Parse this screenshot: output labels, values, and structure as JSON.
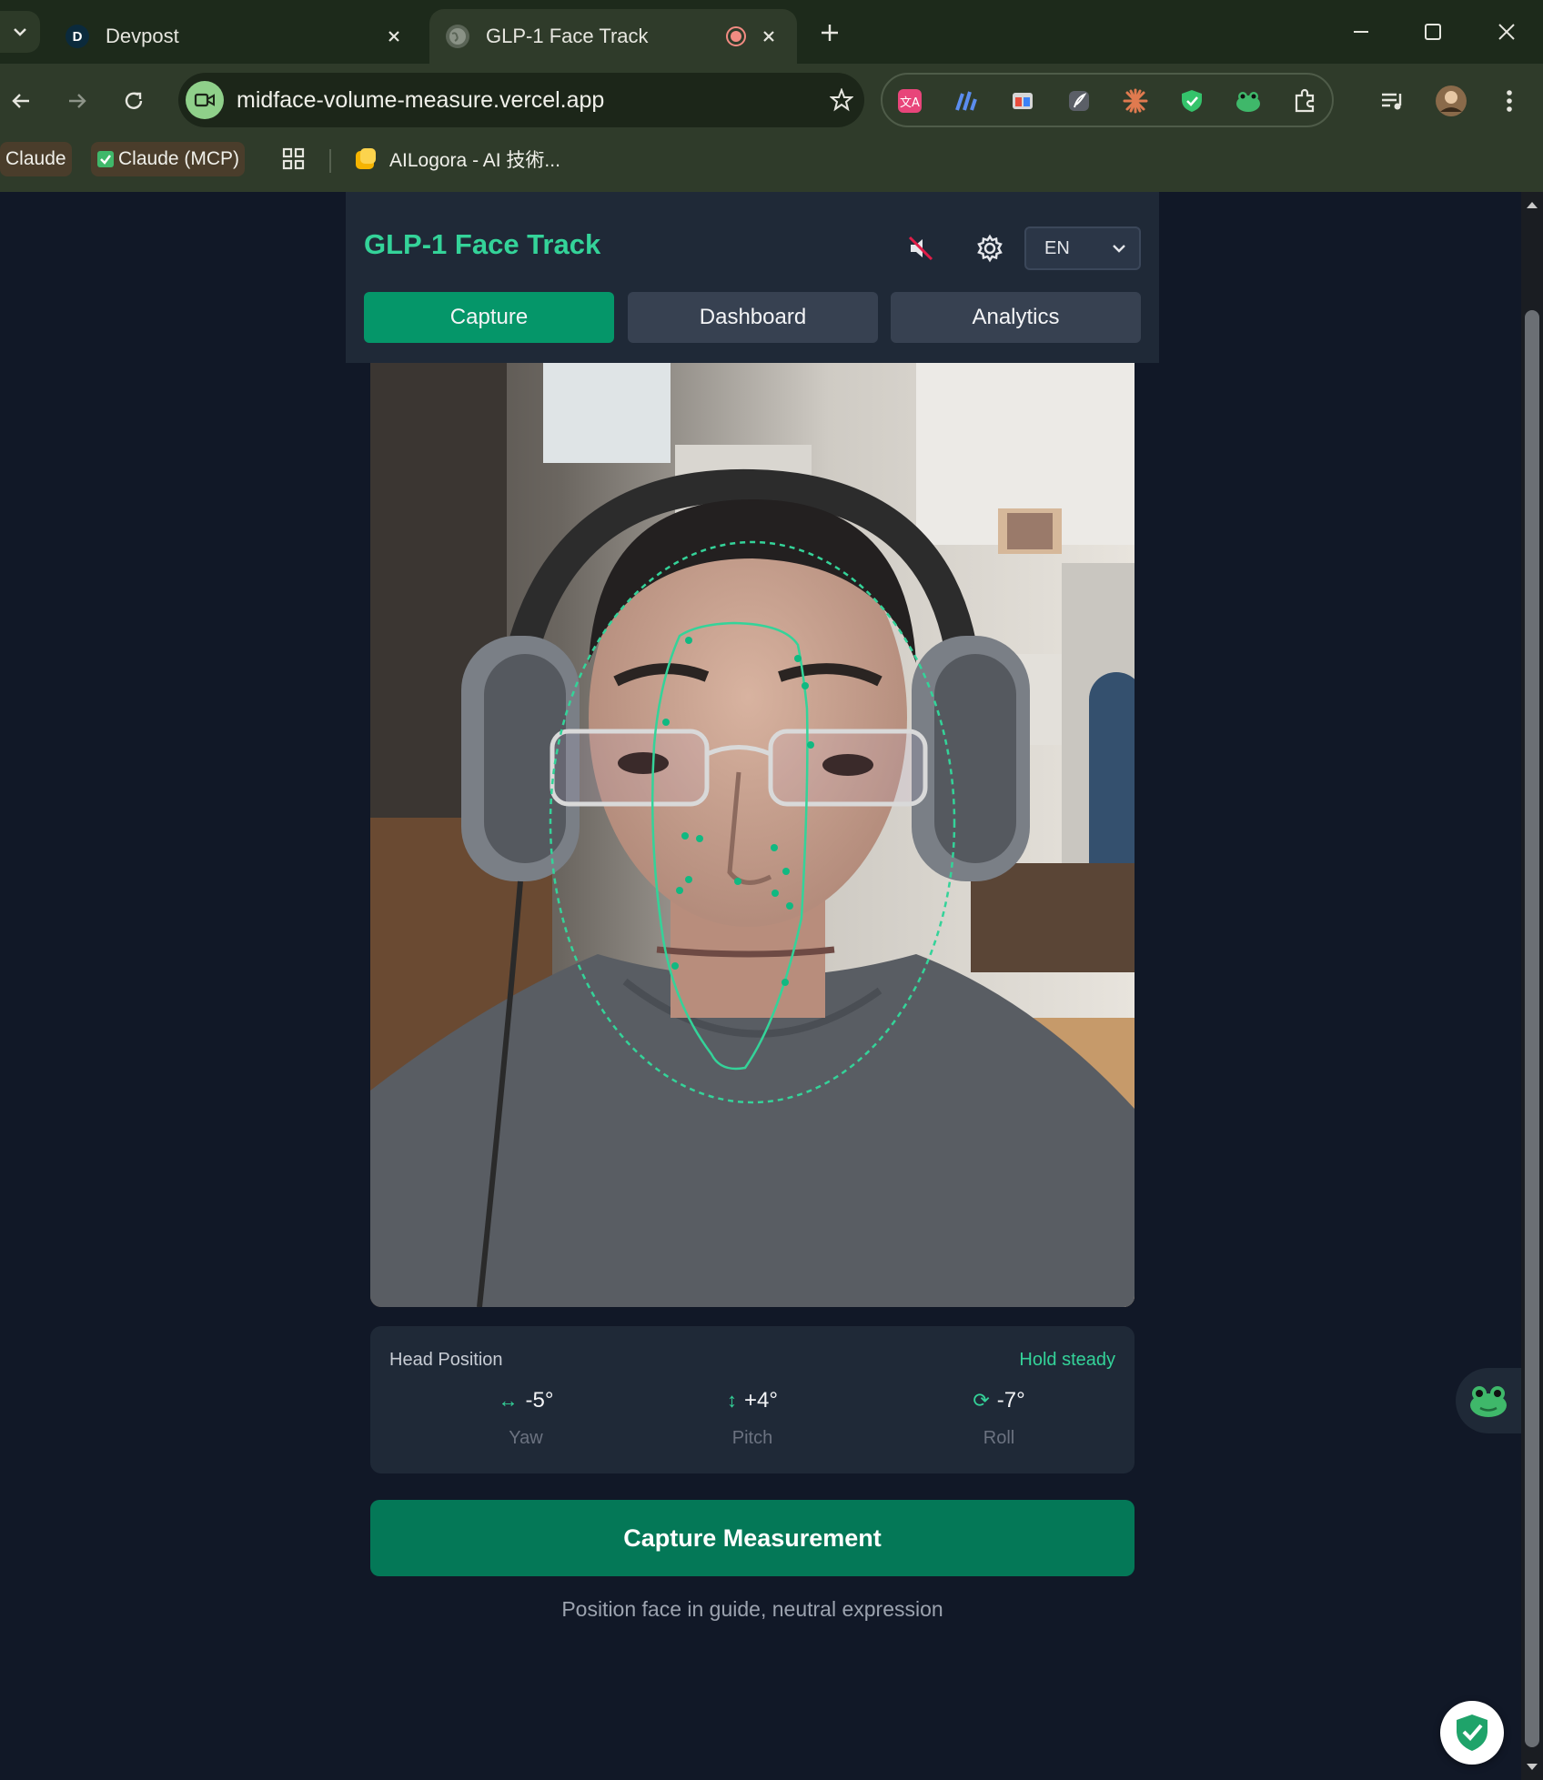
{
  "browser": {
    "tabs": [
      {
        "title": "Devpost",
        "favicon_letter": "D",
        "active": false
      },
      {
        "title": "GLP-1 Face Track",
        "active": true
      }
    ],
    "url": "midface-volume-measure.vercel.app",
    "bookmarks": [
      {
        "label": "Claude"
      },
      {
        "label": "Claude (MCP)"
      },
      {
        "label": "AILogora - AI 技術..."
      }
    ]
  },
  "app": {
    "title": "GLP-1 Face Track",
    "language": "EN",
    "nav_tabs": [
      {
        "label": "Capture",
        "active": true
      },
      {
        "label": "Dashboard",
        "active": false
      },
      {
        "label": "Analytics",
        "active": false
      }
    ],
    "head_position": {
      "title": "Head Position",
      "status": "Hold steady",
      "metrics": [
        {
          "label": "Yaw",
          "value": "-5°",
          "icon": "horizontal-arrow-icon"
        },
        {
          "label": "Pitch",
          "value": "+4°",
          "icon": "vertical-arrow-icon"
        },
        {
          "label": "Roll",
          "value": "-7°",
          "icon": "rotate-icon"
        }
      ]
    },
    "capture_button": "Capture Measurement",
    "hint": "Position face in guide, neutral expression"
  },
  "colors": {
    "accent": "#34d399",
    "active_tab": "#059669",
    "capture_button": "#047857",
    "page_bg": "#111827",
    "panel_bg": "#1f2937"
  }
}
